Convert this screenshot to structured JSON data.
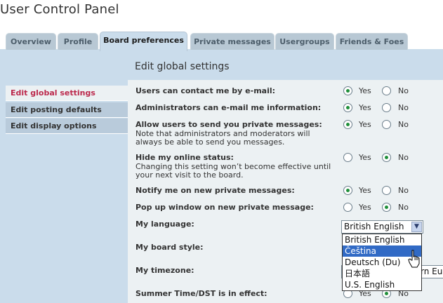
{
  "page": {
    "title": "User Control Panel"
  },
  "tabs": [
    "Overview",
    "Profile",
    "Board preferences",
    "Private messages",
    "Usergroups",
    "Friends & Foes"
  ],
  "active_tab": "Board preferences",
  "section": {
    "title": "Edit global settings"
  },
  "menu": [
    "Edit global settings",
    "Edit posting defaults",
    "Edit display options"
  ],
  "active_menu": "Edit global settings",
  "settings": [
    {
      "label": "Users can contact me by e-mail:",
      "explain": "",
      "yes": "Yes",
      "no": "No",
      "selected": "Yes"
    },
    {
      "label": "Administrators can e-mail me information:",
      "explain": "",
      "yes": "Yes",
      "no": "No",
      "selected": "Yes"
    },
    {
      "label": "Allow users to send you private messages:",
      "explain": "Note that administrators and moderators will always be able to send you messages.",
      "yes": "Yes",
      "no": "No",
      "selected": "Yes"
    },
    {
      "label": "Hide my online status:",
      "explain": "Changing this setting won’t become effective until your next visit to the board.",
      "yes": "Yes",
      "no": "No",
      "selected": "No"
    },
    {
      "label": "Notify me on new private messages:",
      "explain": "",
      "yes": "Yes",
      "no": "No",
      "selected": "Yes"
    },
    {
      "label": "Pop up window on new private message:",
      "explain": "",
      "yes": "Yes",
      "no": "No",
      "selected": "No"
    }
  ],
  "language": {
    "label": "My language:",
    "selected": "British English",
    "options": [
      "British English",
      "Čeština",
      "Deutsch (Du)",
      "日本語",
      "U.S. English"
    ],
    "highlighted": "Čeština"
  },
  "board_style": {
    "label": "My board style:"
  },
  "timezone": {
    "label": "My timezone:",
    "partial_value": "rn Eu"
  },
  "dst": {
    "label": "Summer Time/DST is in effect:",
    "yes": "Yes",
    "no": "No",
    "selected": "No"
  },
  "colors": {
    "panel_bg": "#cadceb",
    "content_bg": "#ecf1f3",
    "active_menu_text": "#bc2a4d",
    "radio_checked": "#1f8f3a",
    "dropdown_highlight": "#316ac5"
  }
}
